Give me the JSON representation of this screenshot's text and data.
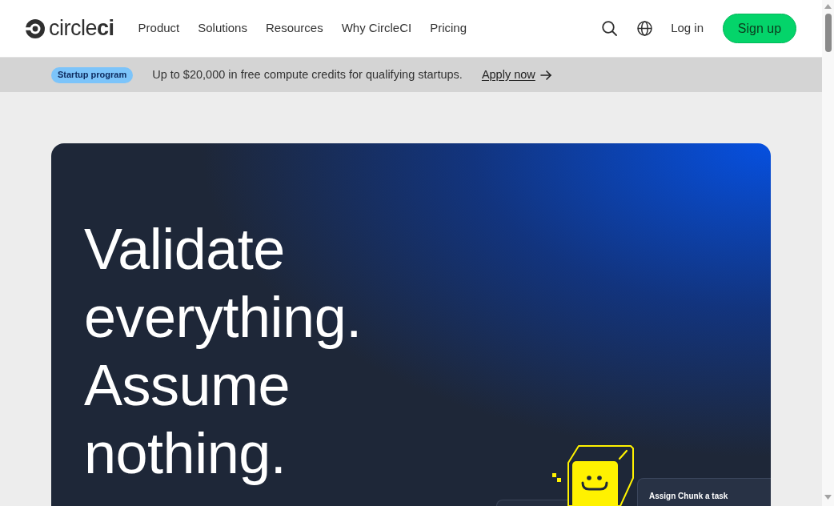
{
  "header": {
    "logo": "circle**ci**",
    "nav": [
      "Product",
      "Solutions",
      "Resources",
      "Why CircleCI",
      "Pricing"
    ],
    "login": "Log in",
    "signup": "Sign up"
  },
  "banner": {
    "badge": "Startup program",
    "text": "Up to $20,000 in free compute credits for qualifying startups.",
    "link": "Apply now"
  },
  "hero": {
    "headline": "Validate everything. Assume nothing.",
    "task_card": {
      "title": "Assign Chunk a task"
    }
  }
}
